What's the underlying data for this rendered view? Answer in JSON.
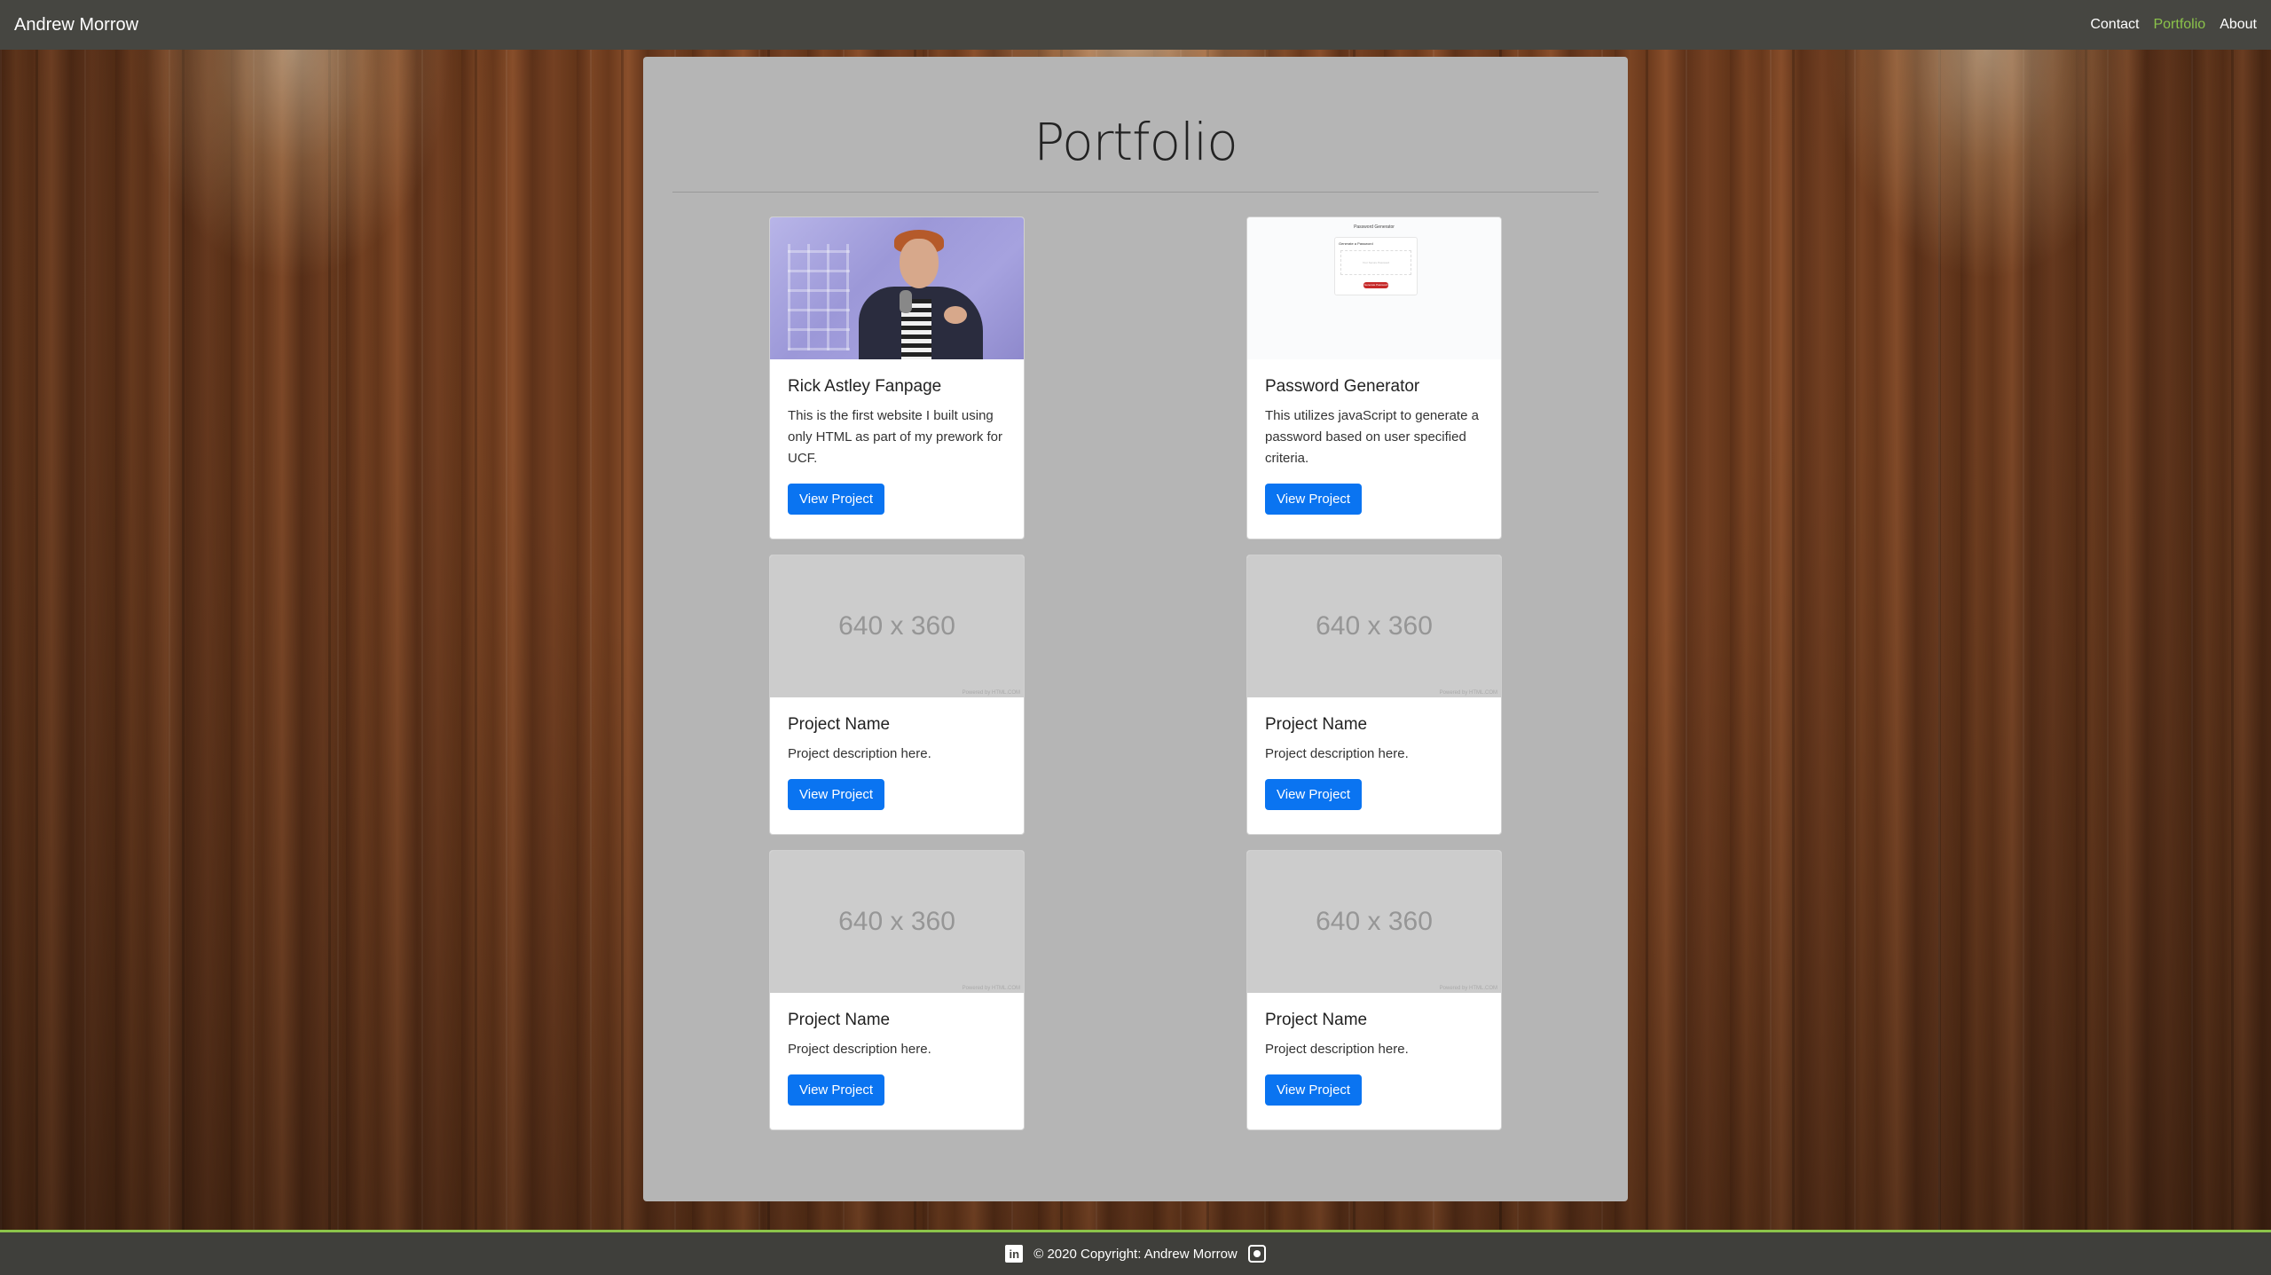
{
  "navbar": {
    "brand": "Andrew Morrow",
    "links": [
      "Contact",
      "Portfolio",
      "About"
    ],
    "active": "Portfolio"
  },
  "page": {
    "title": "Portfolio"
  },
  "cards": [
    {
      "title": "Rick Astley Fanpage",
      "description": "This is the first website I built using only HTML as part of my prework for UCF.",
      "button": "View Project",
      "image": "rick-astley-photo"
    },
    {
      "title": "Password Generator",
      "description": "This utilizes javaScript to generate a password based on user specified criteria.",
      "button": "View Project",
      "image": "password-generator-screenshot"
    },
    {
      "title": "Project Name",
      "description": "Project description here.",
      "button": "View Project",
      "image_text": "640 x 360"
    },
    {
      "title": "Project Name",
      "description": "Project description here.",
      "button": "View Project",
      "image_text": "640 x 360"
    },
    {
      "title": "Project Name",
      "description": "Project description here.",
      "button": "View Project",
      "image_text": "640 x 360"
    },
    {
      "title": "Project Name",
      "description": "Project description here.",
      "button": "View Project",
      "image_text": "640 x 360"
    }
  ],
  "footer": {
    "copyright": "© 2020 Copyright: Andrew Morrow",
    "icons": [
      "linkedin-icon",
      "github-icon"
    ]
  },
  "colors": {
    "navbar_bg": "#464641",
    "active_link": "#8bc34a",
    "button": "#0a74f1",
    "panel": "#b5b5b5"
  }
}
